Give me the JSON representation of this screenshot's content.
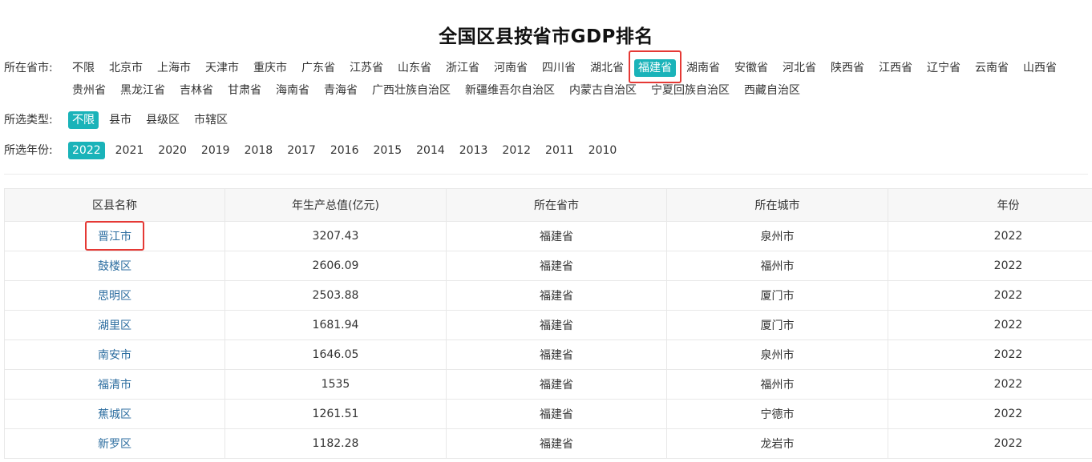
{
  "page": {
    "title": "全国区县按省市GDP排名"
  },
  "filters": {
    "province": {
      "label": "所在省市:",
      "options": [
        "不限",
        "北京市",
        "上海市",
        "天津市",
        "重庆市",
        "广东省",
        "江苏省",
        "山东省",
        "浙江省",
        "河南省",
        "四川省",
        "湖北省",
        "福建省",
        "湖南省",
        "安徽省",
        "河北省",
        "陕西省",
        "江西省",
        "辽宁省",
        "云南省",
        "山西省",
        "贵州省",
        "黑龙江省",
        "吉林省",
        "甘肃省",
        "海南省",
        "青海省",
        "广西壮族自治区",
        "新疆维吾尔自治区",
        "内蒙古自治区",
        "宁夏回族自治区",
        "西藏自治区"
      ],
      "selected_index": 12
    },
    "type": {
      "label": "所选类型:",
      "options": [
        "不限",
        "县市",
        "县级区",
        "市辖区"
      ],
      "selected_index": 0
    },
    "year": {
      "label": "所选年份:",
      "options": [
        "2022",
        "2021",
        "2020",
        "2019",
        "2018",
        "2017",
        "2016",
        "2015",
        "2014",
        "2013",
        "2012",
        "2011",
        "2010"
      ],
      "selected_index": 0
    }
  },
  "table": {
    "columns": [
      "区县名称",
      "年生产总值(亿元)",
      "所在省市",
      "所在城市",
      "年份"
    ],
    "rows": [
      [
        "晋江市",
        "3207.43",
        "福建省",
        "泉州市",
        "2022"
      ],
      [
        "鼓楼区",
        "2606.09",
        "福建省",
        "福州市",
        "2022"
      ],
      [
        "思明区",
        "2503.88",
        "福建省",
        "厦门市",
        "2022"
      ],
      [
        "湖里区",
        "1681.94",
        "福建省",
        "厦门市",
        "2022"
      ],
      [
        "南安市",
        "1646.05",
        "福建省",
        "泉州市",
        "2022"
      ],
      [
        "福清市",
        "1535",
        "福建省",
        "福州市",
        "2022"
      ],
      [
        "蕉城区",
        "1261.51",
        "福建省",
        "宁德市",
        "2022"
      ],
      [
        "新罗区",
        "1182.28",
        "福建省",
        "龙岩市",
        "2022"
      ]
    ],
    "highlighted_row": 0
  },
  "colors": {
    "accent": "#1ab3b9",
    "link": "#2d6ea0",
    "highlight_box": "#e53935"
  }
}
